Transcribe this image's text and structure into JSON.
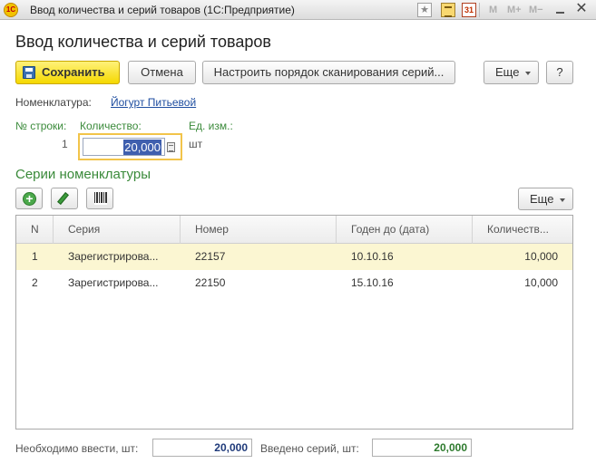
{
  "window": {
    "logo_text": "1С",
    "title": "Ввод количества и серий товаров  (1С:Предприятие)",
    "mem_buttons": [
      "M",
      "M+",
      "M−"
    ],
    "calendar_day": "31",
    "close_glyph": "✕",
    "star_glyph": "★"
  },
  "form": {
    "title": "Ввод количества и серий товаров"
  },
  "toolbar": {
    "save_label": "Сохранить",
    "cancel_label": "Отмена",
    "config_label": "Настроить порядок сканирования серий...",
    "more_label": "Еще",
    "help_label": "?"
  },
  "nomenclature": {
    "label": "Номенклатура:",
    "value": "Йогурт Питьевой"
  },
  "line": {
    "row_no_label": "№ строки:",
    "row_no_value": "1",
    "qty_label": "Количество:",
    "qty_value": "20,000",
    "unit_label": "Ед. изм.:",
    "unit_value": "шт"
  },
  "series_section": {
    "title": "Серии номенклатуры",
    "add_glyph": "+",
    "more_label": "Еще"
  },
  "table": {
    "columns": [
      "N",
      "Серия",
      "Номер",
      "Годен до (дата)",
      "Количеств..."
    ],
    "rows": [
      {
        "n": "1",
        "series": "Зарегистрирова...",
        "number": "22157",
        "expiry": "10.10.16",
        "qty": "10,000",
        "selected": true
      },
      {
        "n": "2",
        "series": "Зарегистрирова...",
        "number": "22150",
        "expiry": "15.10.16",
        "qty": "10,000",
        "selected": false
      }
    ]
  },
  "footer": {
    "need_label": "Необходимо ввести, шт:",
    "need_value": "20,000",
    "entered_label": "Введено серий, шт:",
    "entered_value": "20,000"
  },
  "colors": {
    "accent_yellow": "#f5d800",
    "green_label": "#3a8a3a",
    "link_blue": "#1f4ea0",
    "selected_row": "#fbf6d2"
  }
}
